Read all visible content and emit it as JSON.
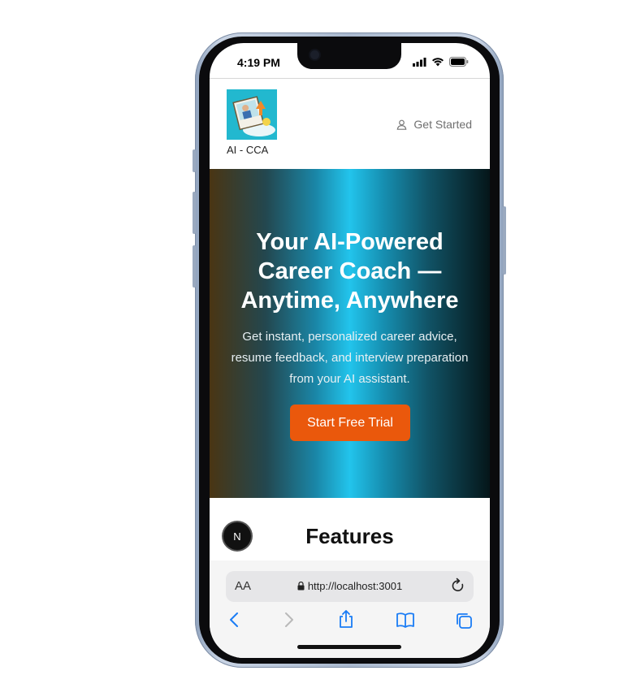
{
  "status_bar": {
    "time": "4:19 PM"
  },
  "app": {
    "logo_label": "AI - CCA",
    "get_started_label": "Get Started"
  },
  "hero": {
    "title": "Your AI-Powered Career Coach — Anytime, Anywhere",
    "subtitle": "Get instant, personalized career advice, resume feedback, and interview preparation from your AI assistant.",
    "cta_label": "Start Free Trial"
  },
  "features": {
    "heading": "Features"
  },
  "dev_badge": {
    "label": "N"
  },
  "browser": {
    "aa_label": "AA",
    "url": "http://localhost:3001"
  },
  "colors": {
    "cta": "#ea580c",
    "accent_blue": "#22c4ec",
    "ios_blue": "#1a7cf5"
  }
}
